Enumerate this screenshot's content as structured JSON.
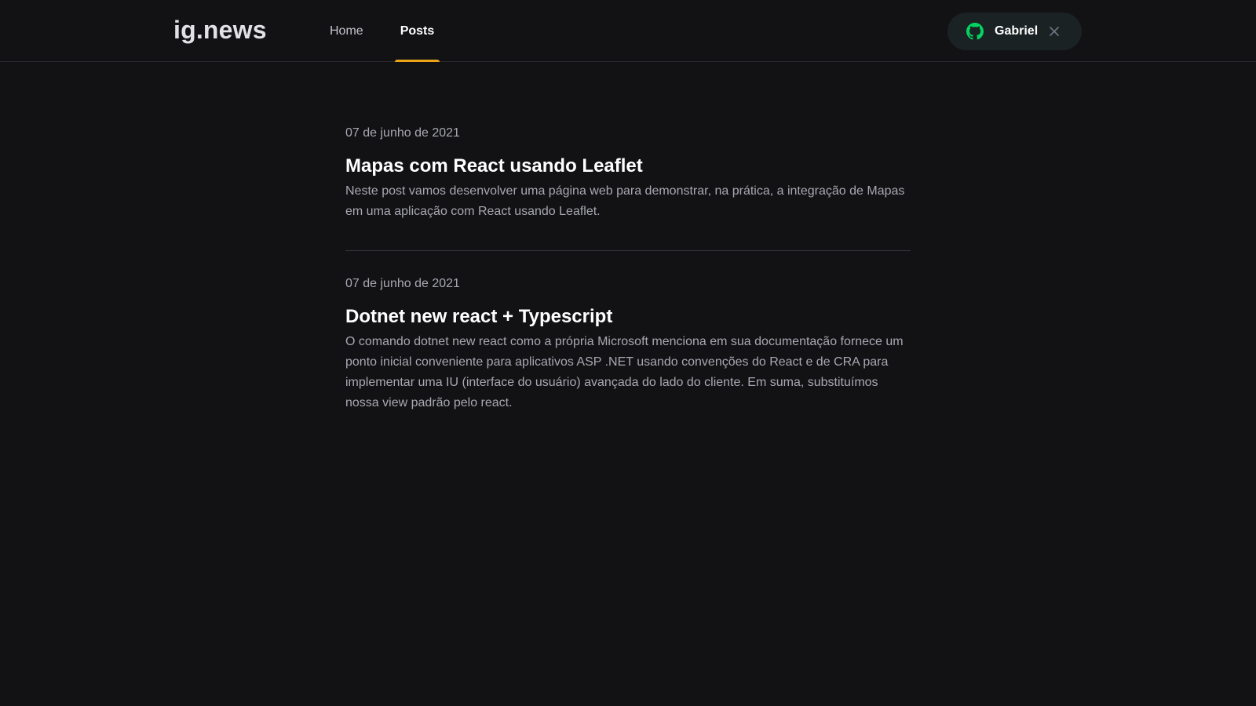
{
  "header": {
    "logo": "ig.news",
    "nav": [
      {
        "label": "Home",
        "active": false
      },
      {
        "label": "Posts",
        "active": true
      }
    ],
    "signin": {
      "user_name": "Gabriel",
      "icon": "github-icon",
      "icon_color": "#04d361",
      "close_icon": "close-icon"
    },
    "active_color": "#eba417"
  },
  "posts": [
    {
      "date": "07 de junho de 2021",
      "title": "Mapas com React usando Leaflet",
      "excerpt": "Neste post vamos desenvolver uma página web para demonstrar, na prática, a integração de Mapas em uma aplicação com React usando Leaflet."
    },
    {
      "date": "07 de junho de 2021",
      "title": "Dotnet new react + Typescript",
      "excerpt": "O comando dotnet new react como a própria Microsoft menciona em sua documentação fornece um ponto inicial conveniente para aplicativos ASP .NET usando convenções do React e de CRA para implementar uma IU (interface do usuário) avançada do lado do cliente. Em suma, substituímos nossa view padrão pelo react."
    }
  ]
}
